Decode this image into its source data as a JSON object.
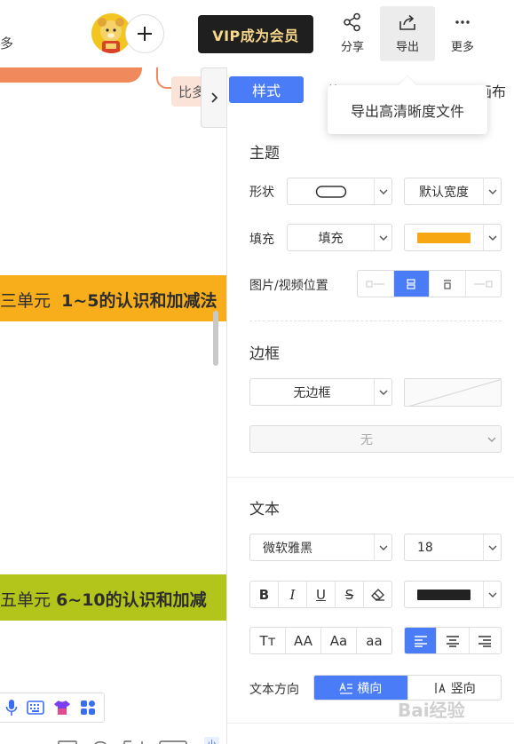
{
  "toolbar": {
    "edge_text": "多",
    "vip_label": "VIP成为会员",
    "share_label": "分享",
    "export_label": "导出",
    "more_label": "更多"
  },
  "canvas": {
    "chip_bi_text": "比多",
    "node_unit3_prefix": "三单元",
    "node_unit3_title": "1~5的认识和加减法",
    "node_unit5_prefix": "五单元",
    "node_unit5_title": "6~10的认识和加减",
    "bottom_badge": "小"
  },
  "tooltip": {
    "text": "导出高清晰度文件"
  },
  "panel": {
    "tab_style": "样式",
    "tab_middle_frag": "的",
    "tab_canvas_frag": "画布",
    "theme": {
      "title": "主题",
      "shape_label": "形状",
      "width_value": "默认宽度",
      "fill_label": "填充",
      "fill_value": "填充",
      "fill_color": "#f7a711",
      "image_pos_label": "图片/视频位置"
    },
    "border": {
      "title": "边框",
      "style_value": "无边框",
      "secondary_value": "无"
    },
    "text": {
      "title": "文本",
      "font_value": "微软雅黑",
      "size_value": "18",
      "color": "#222222",
      "case_options": [
        "Tт",
        "AA",
        "Aa",
        "aa"
      ],
      "direction_label": "文本方向",
      "direction_horizontal": "横向",
      "direction_vertical": "竖向"
    }
  },
  "watermark": "Bai经验",
  "colors": {
    "accent": "#4a7cf7",
    "orange_node": "#f8ad1a",
    "green_node": "#b3c41a",
    "top_node": "#f08a5d"
  }
}
